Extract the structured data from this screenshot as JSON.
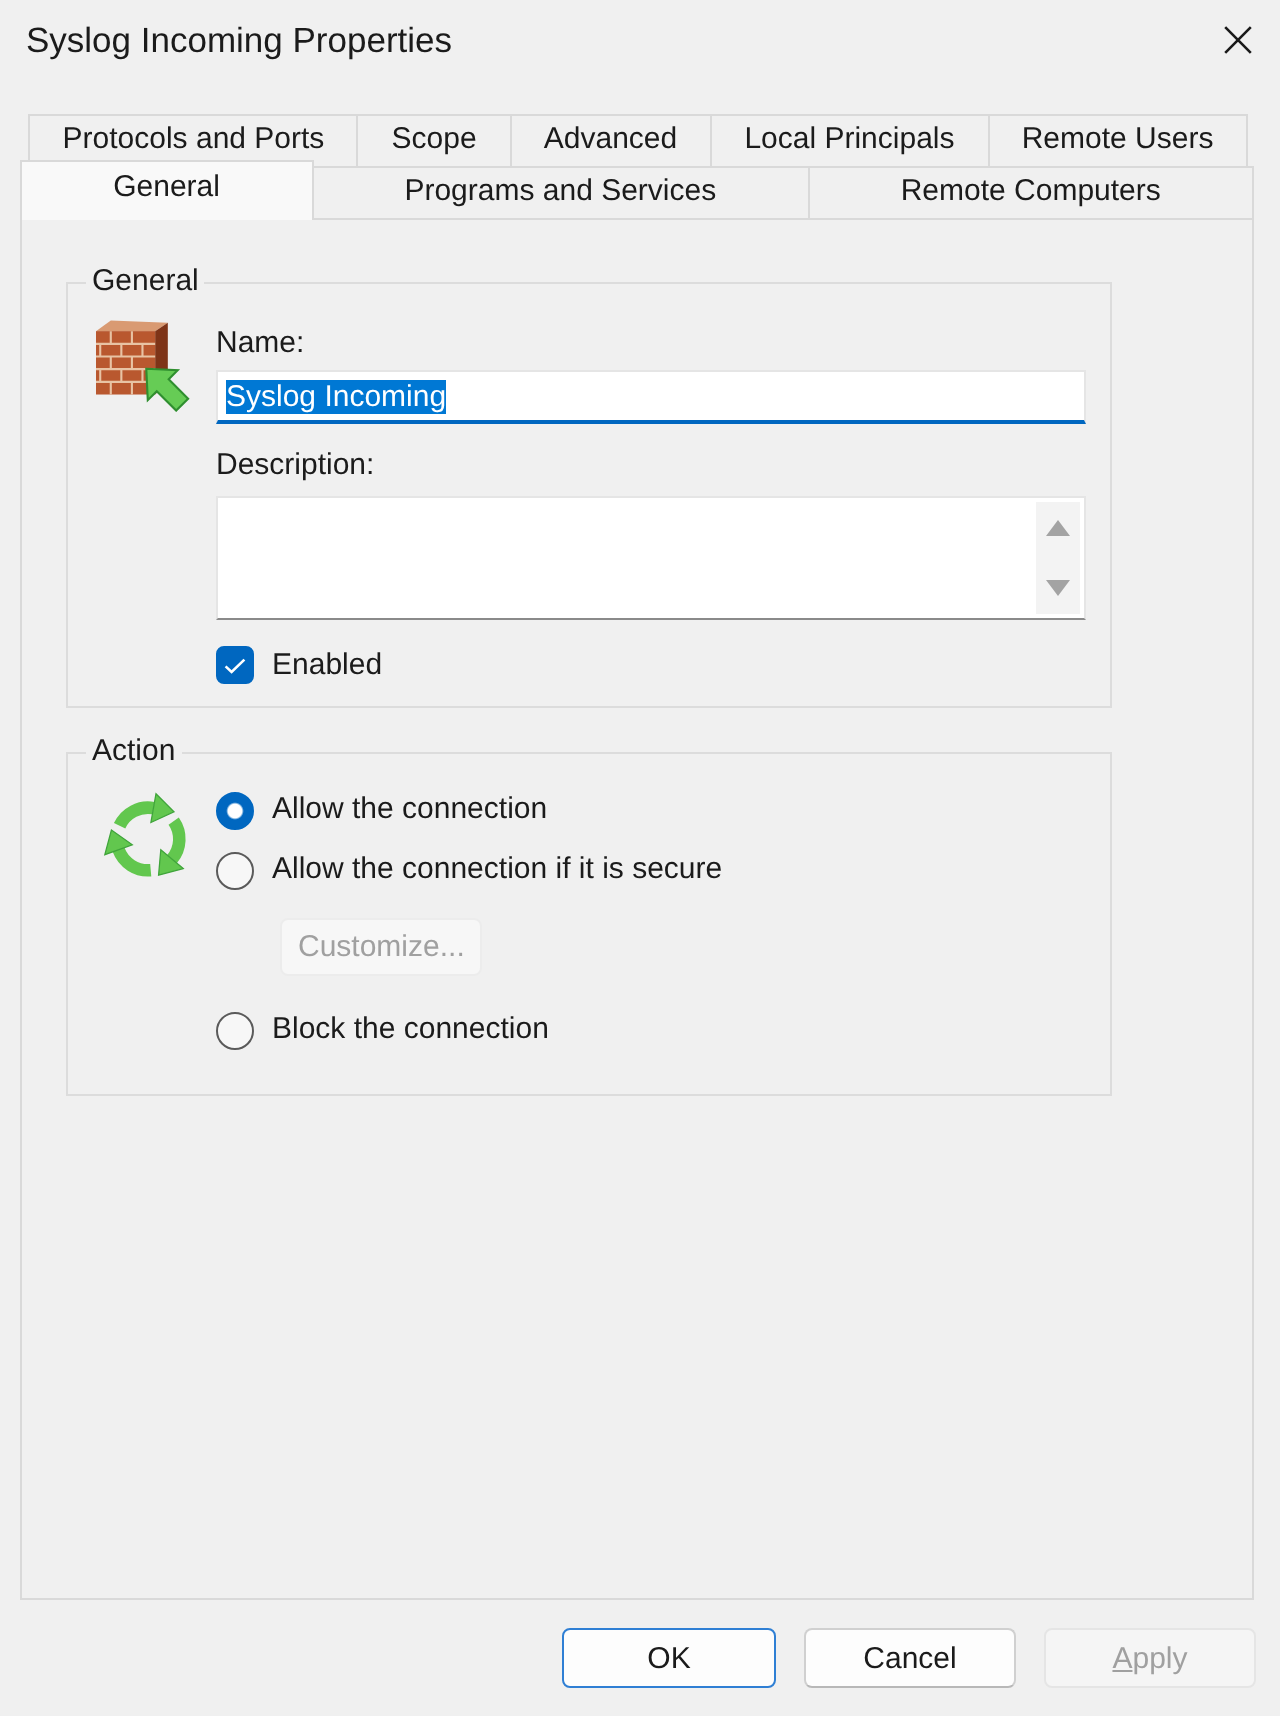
{
  "window": {
    "title": "Syslog Incoming Properties"
  },
  "tab_rows": [
    {
      "tabs": [
        {
          "label": "Protocols and Ports",
          "selected": false
        },
        {
          "label": "Scope",
          "selected": false
        },
        {
          "label": "Advanced",
          "selected": false
        },
        {
          "label": "Local Principals",
          "selected": false
        },
        {
          "label": "Remote Users",
          "selected": false
        }
      ]
    },
    {
      "tabs": [
        {
          "label": "General",
          "selected": true
        },
        {
          "label": "Programs and Services",
          "selected": false
        },
        {
          "label": "Remote Computers",
          "selected": false
        }
      ]
    }
  ],
  "general": {
    "legend": "General",
    "name": {
      "label": "Name:",
      "value": "Syslog Incoming",
      "focused": true,
      "text_selected": true
    },
    "description": {
      "label": "Description:"
    },
    "enabled": {
      "label": "Enabled",
      "checked": true
    }
  },
  "action": {
    "legend": "Action",
    "options": [
      {
        "label": "Allow the connection",
        "selected": true
      },
      {
        "label": "Allow the connection if it is secure",
        "selected": false,
        "button": {
          "label": "Customize...",
          "disabled": true
        }
      },
      {
        "label": "Block the connection",
        "selected": false
      }
    ]
  },
  "buttons": [
    {
      "label": "OK",
      "default": true,
      "disabled": false,
      "access_key_underlined": false
    },
    {
      "label": "Cancel",
      "default": false,
      "disabled": false,
      "access_key_underlined": false
    },
    {
      "label": "Apply",
      "default": false,
      "disabled": true,
      "access_key_underlined": true
    }
  ]
}
